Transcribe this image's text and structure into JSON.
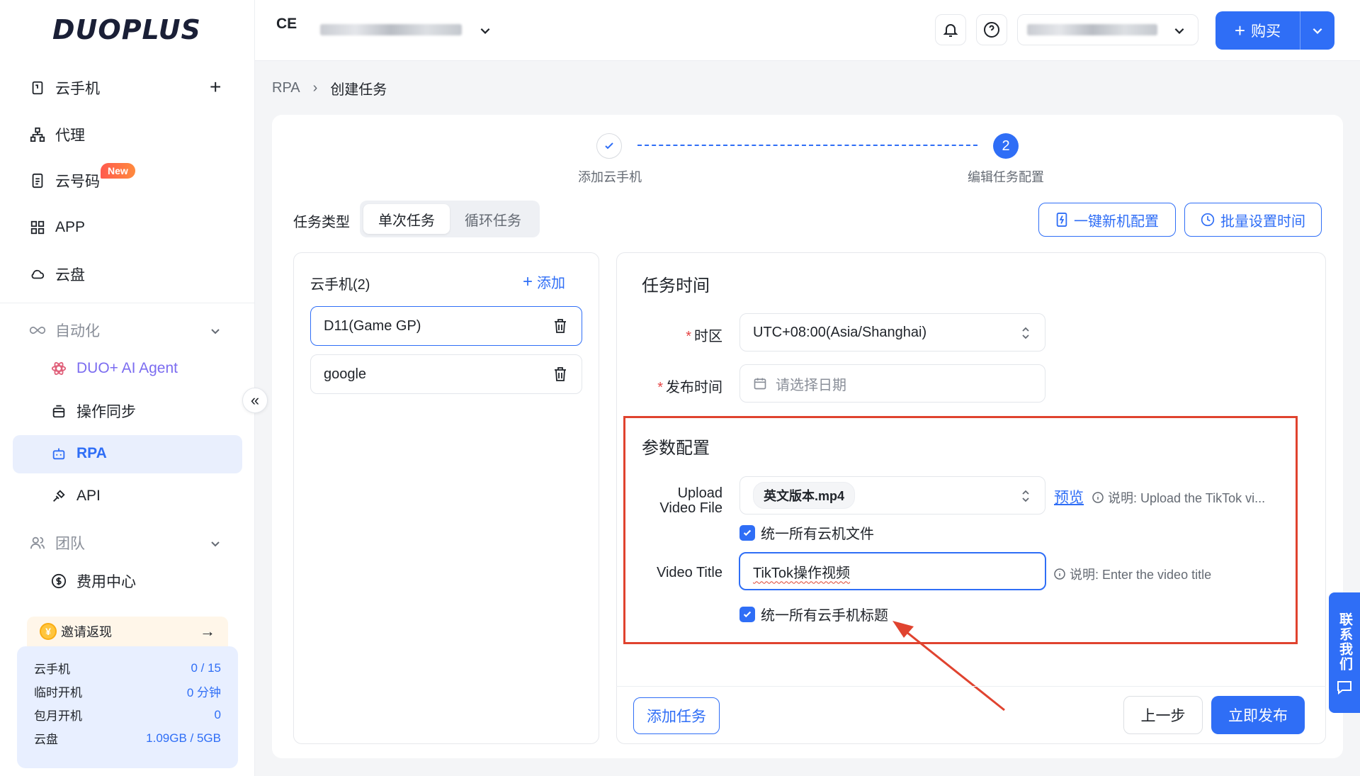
{
  "brand": {
    "logo_text": "DUOPLUS"
  },
  "sidebar": {
    "items": [
      {
        "label": "云手机",
        "icon": "phone-icon"
      },
      {
        "label": "代理",
        "icon": "network-icon"
      },
      {
        "label": "云号码",
        "icon": "sim-icon",
        "badge": "New"
      },
      {
        "label": "APP",
        "icon": "apps-grid-icon"
      },
      {
        "label": "云盘",
        "icon": "cloud-icon"
      }
    ],
    "automation": {
      "header": "自动化",
      "items": [
        {
          "label": "DUO+ AI Agent",
          "icon": "ai-agent-icon"
        },
        {
          "label": "操作同步",
          "icon": "sync-icon"
        },
        {
          "label": "RPA",
          "icon": "robot-icon",
          "active": true
        },
        {
          "label": "API",
          "icon": "api-plug-icon"
        }
      ]
    },
    "team": {
      "header": "团队",
      "items": [
        {
          "label": "费用中心",
          "icon": "dollar-icon"
        }
      ]
    },
    "invite": {
      "label": "邀请返现",
      "arrow": "→"
    },
    "stats": [
      {
        "label": "云手机",
        "value": "0 / 15"
      },
      {
        "label": "临时开机",
        "value": "0 分钟"
      },
      {
        "label": "包月开机",
        "value": "0"
      },
      {
        "label": "云盘",
        "value": "1.09GB / 5GB"
      }
    ]
  },
  "header": {
    "workspace_initials": "CE",
    "buy_label": "购买"
  },
  "breadcrumb": {
    "root": "RPA",
    "separator": "›",
    "current": "创建任务"
  },
  "steps": [
    {
      "label": "添加云手机",
      "state": "done"
    },
    {
      "label": "编辑任务配置",
      "number": "2",
      "state": "active"
    }
  ],
  "task_type": {
    "label": "任务类型",
    "options": [
      "单次任务",
      "循环任务"
    ],
    "selected": "单次任务"
  },
  "actions": {
    "new_device_config": "一键新机配置",
    "batch_time": "批量设置时间"
  },
  "phones": {
    "title": "云手机(2)",
    "add_label": "添加",
    "items": [
      "D11(Game GP)",
      "google"
    ],
    "selected_index": 0
  },
  "task_time": {
    "title": "任务时间",
    "timezone_label": "时区",
    "timezone_value": "UTC+08:00(Asia/Shanghai)",
    "publish_label": "发布时间",
    "publish_placeholder": "请选择日期"
  },
  "params": {
    "title": "参数配置",
    "upload_label_line1": "Upload",
    "upload_label_line2": "Video File",
    "file_name": "英文版本.mp4",
    "preview_label": "预览",
    "upload_note": "说明: Upload the TikTok vi...",
    "unify_files_label": "统一所有云机文件",
    "video_title_label": "Video Title",
    "video_title_value": "TikTok操作视频",
    "video_title_note": "说明: Enter the video title",
    "unify_title_label": "统一所有云手机标题"
  },
  "footer": {
    "add_task": "添加任务",
    "prev": "上一步",
    "publish": "立即发布"
  },
  "contact": {
    "label": "联系我们"
  },
  "colors": {
    "primary": "#2f6ef6",
    "highlight": "#e0432f",
    "badge": "#ff5a4e"
  }
}
